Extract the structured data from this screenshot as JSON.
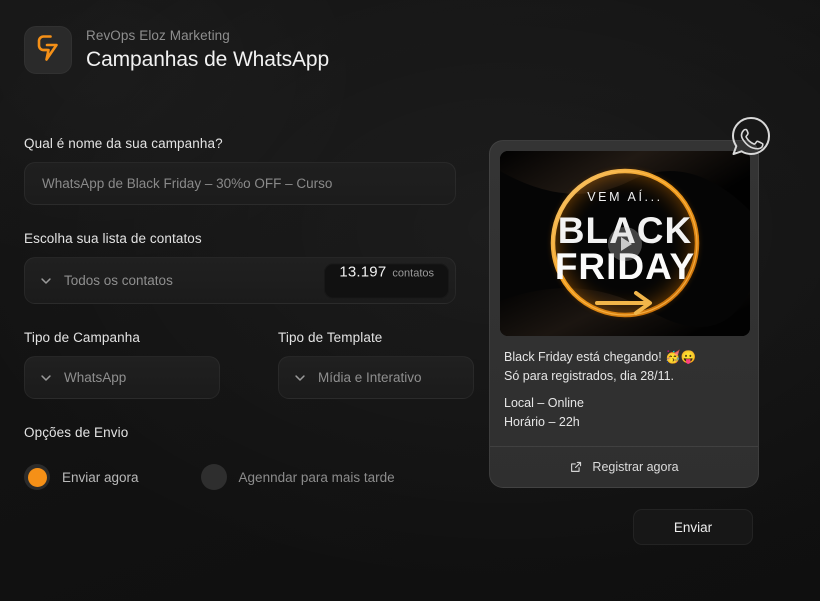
{
  "header": {
    "logo_icon": "lightning-bolt-icon",
    "brand": "RevOps Eloz Marketing",
    "title": "Campanhas de WhatsApp"
  },
  "form": {
    "campaign_name": {
      "label": "Qual é nome da sua campanha?",
      "value": "WhatsApp de Black Friday – 30%o OFF – Curso"
    },
    "contact_list": {
      "label": "Escolha sua lista de contatos",
      "value": "Todos os contatos",
      "chevron_icon": "chevron-down-icon",
      "count": "13.197",
      "count_word": "contatos"
    },
    "campaign_type": {
      "label": "Tipo de Campanha",
      "value": "WhatsApp",
      "chevron_icon": "chevron-down-icon"
    },
    "template_type": {
      "label": "Tipo de Template",
      "value": "Mídia e Interativo",
      "chevron_icon": "chevron-down-icon"
    },
    "send_options": {
      "label": "Opções de Envio",
      "option_now": "Enviar agora",
      "option_later": "Agenndar para mais tarde",
      "selected": "Enviar agora"
    },
    "submit_label": "Enviar"
  },
  "preview": {
    "whatsapp_badge_icon": "whatsapp-icon",
    "media": {
      "play_icon": "play-icon",
      "headline_small": "VEM AÍ...",
      "headline_line1": "BLACK",
      "headline_line2": "FRIDAY",
      "arrow_icon": "arrow-right-icon",
      "accent_color": "#f9a11b"
    },
    "message_lines": [
      "Black Friday está chegando! 🥳😛",
      "Só para registrados, dia 28/11.",
      "Local – Online",
      "Horário – 22h"
    ],
    "action": {
      "icon": "external-link-icon",
      "label": "Registrar agora"
    }
  },
  "colors": {
    "background": "#121212",
    "accent": "#f59017",
    "card": "#333333",
    "text_primary": "#e8e8e8",
    "text_muted": "#8c8c8c"
  }
}
